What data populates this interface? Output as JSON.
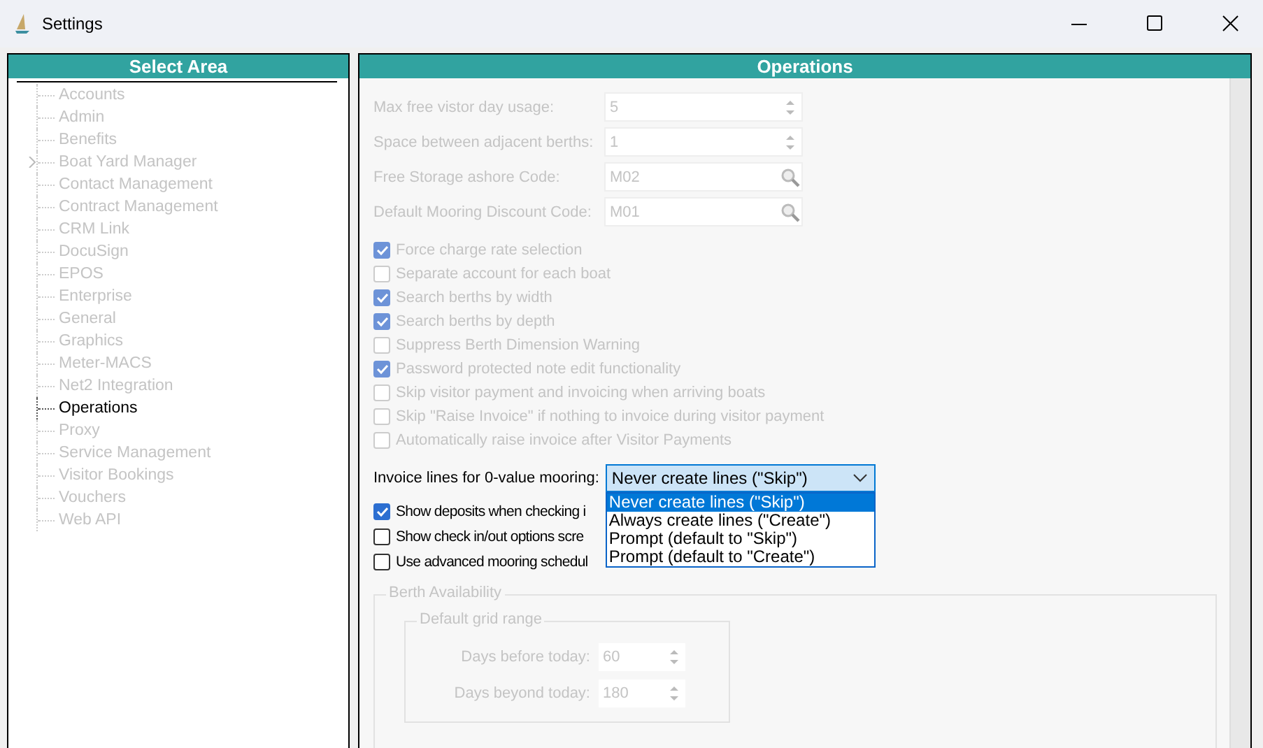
{
  "window": {
    "title": "Settings"
  },
  "sidebar": {
    "title": "Select Area",
    "items": [
      {
        "label": "Accounts",
        "selected": false
      },
      {
        "label": "Admin",
        "selected": false
      },
      {
        "label": "Benefits",
        "selected": false
      },
      {
        "label": "Boat Yard Manager",
        "selected": false,
        "expanded": false
      },
      {
        "label": "Contact Management",
        "selected": false
      },
      {
        "label": "Contract Management",
        "selected": false
      },
      {
        "label": "CRM Link",
        "selected": false
      },
      {
        "label": "DocuSign",
        "selected": false
      },
      {
        "label": "EPOS",
        "selected": false
      },
      {
        "label": "Enterprise",
        "selected": false
      },
      {
        "label": "General",
        "selected": false
      },
      {
        "label": "Graphics",
        "selected": false
      },
      {
        "label": "Meter-MACS",
        "selected": false
      },
      {
        "label": "Net2 Integration",
        "selected": false
      },
      {
        "label": "Operations",
        "selected": true
      },
      {
        "label": "Proxy",
        "selected": false
      },
      {
        "label": "Service Management",
        "selected": false
      },
      {
        "label": "Visitor Bookings",
        "selected": false
      },
      {
        "label": "Vouchers",
        "selected": false
      },
      {
        "label": "Web API",
        "selected": false
      }
    ]
  },
  "panel": {
    "title": "Operations",
    "fields": [
      {
        "label": "Max free vistor day usage:",
        "value": "5",
        "kind": "spin",
        "dimmed": true
      },
      {
        "label": "Space between adjacent berths:",
        "value": "1",
        "kind": "spin",
        "dimmed": true
      },
      {
        "label": "Free Storage ashore Code:",
        "value": "M02",
        "kind": "lookup",
        "dimmed": true
      },
      {
        "label": "Default Mooring Discount Code:",
        "value": "M01",
        "kind": "lookup",
        "dimmed": true
      }
    ],
    "options": [
      {
        "label": "Force charge rate selection",
        "checked": true,
        "dimmed": true
      },
      {
        "label": "Separate account for each boat",
        "checked": false,
        "dimmed": true
      },
      {
        "label": "Search berths by width",
        "checked": true,
        "dimmed": true
      },
      {
        "label": "Search berths by depth",
        "checked": true,
        "dimmed": true
      },
      {
        "label": "Suppress Berth Dimension Warning",
        "checked": false,
        "dimmed": true
      },
      {
        "label": "Password protected note edit functionality",
        "checked": true,
        "dimmed": true
      },
      {
        "label": "Skip visitor payment and invoicing when arriving boats",
        "checked": false,
        "dimmed": true
      },
      {
        "label": "Skip \"Raise Invoice\" if nothing to invoice during visitor payment",
        "checked": false,
        "dimmed": true
      },
      {
        "label": "Automatically raise invoice after Visitor Payments",
        "checked": false,
        "dimmed": true
      }
    ],
    "invoice_lines": {
      "label": "Invoice lines for 0-value mooring:",
      "value": "Never create lines (\"Skip\")",
      "expanded": true,
      "options": [
        {
          "label": "Never create lines (\"Skip\")",
          "selected": true
        },
        {
          "label": "Always create lines (\"Create\")",
          "selected": false
        },
        {
          "label": "Prompt (default to \"Skip\")",
          "selected": false
        },
        {
          "label": "Prompt (default to \"Create\")",
          "selected": false
        }
      ]
    },
    "bottom_options": [
      {
        "label": "Show deposits when checking i",
        "checked": true,
        "dimmed": false
      },
      {
        "label": "Show check in/out options scre",
        "checked": false,
        "dimmed": false
      },
      {
        "label": "Use advanced mooring schedul",
        "checked": false,
        "dimmed": false
      }
    ],
    "berth_availability": {
      "title": "Berth Availability",
      "dimmed": true,
      "grid_range": {
        "title": "Default grid range",
        "fields": [
          {
            "label": "Days before today:",
            "value": "60"
          },
          {
            "label": "Days beyond today:",
            "value": "180"
          }
        ]
      }
    }
  }
}
